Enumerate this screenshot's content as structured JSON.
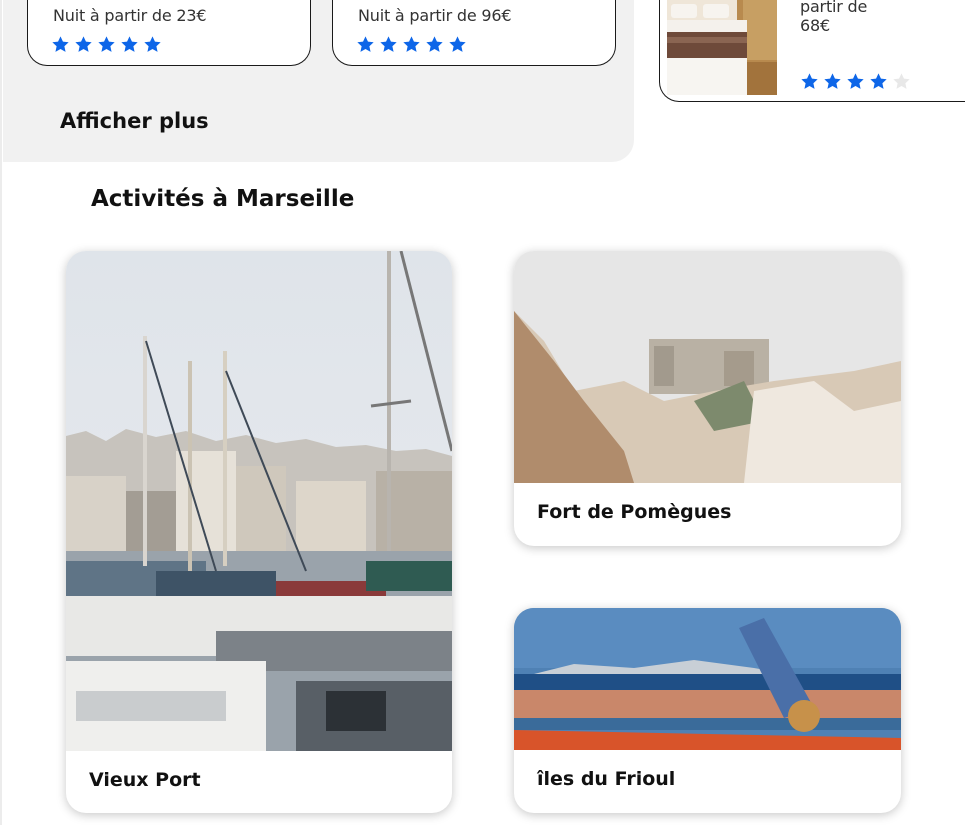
{
  "hotels": {
    "cards": [
      {
        "price": "Nuit à partir de 23€",
        "rating": 5
      },
      {
        "price": "Nuit à partir de 96€",
        "rating": 5
      },
      {
        "price_line1": "partir de",
        "price_line2": "68€",
        "rating": 4
      }
    ],
    "show_more_label": "Afficher plus",
    "star_color": "#0e66e8",
    "star_empty_color": "#e8e8e8"
  },
  "activities": {
    "title": "Activités à Marseille",
    "items": [
      {
        "label": "Vieux Port",
        "icon": "harbor-photo"
      },
      {
        "label": "Fort de Pomègues",
        "icon": "fort-photo"
      },
      {
        "label": "îles du Frioul",
        "icon": "islands-photo"
      }
    ]
  }
}
